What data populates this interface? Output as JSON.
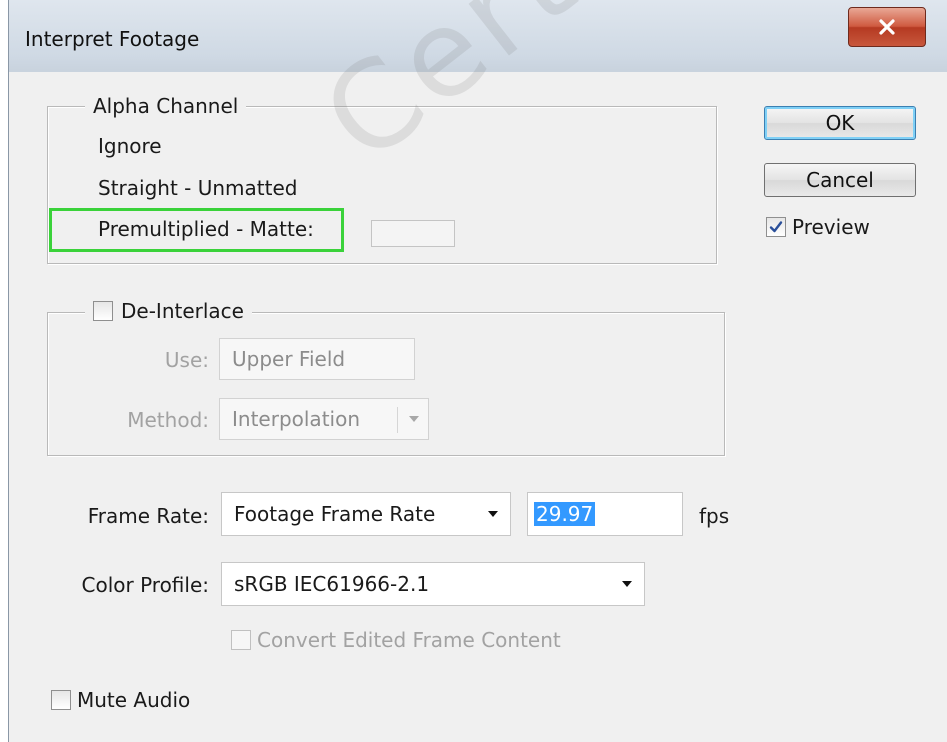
{
  "dialog": {
    "title": "Interpret Footage",
    "close_glyph": "✕"
  },
  "alpha_channel": {
    "legend": "Alpha Channel",
    "options": [
      "Ignore",
      "Straight - Unmatted",
      "Premultiplied - Matte:"
    ]
  },
  "buttons": {
    "ok": "OK",
    "cancel": "Cancel"
  },
  "preview": {
    "label": "Preview",
    "checked": true
  },
  "deinterlace": {
    "legend": "De-Interlace",
    "checked": false,
    "use_label": "Use:",
    "use_value": "Upper Field",
    "method_label": "Method:",
    "method_value": "Interpolation"
  },
  "frame_rate": {
    "label": "Frame Rate:",
    "value": "Footage Frame Rate",
    "fps_value": "29.97",
    "fps_unit": "fps"
  },
  "color_profile": {
    "label": "Color Profile:",
    "value": "sRGB IEC61966-2.1",
    "convert_label": "Convert Edited Frame Content",
    "convert_checked": false
  },
  "mute_audio": {
    "label": "Mute Audio",
    "checked": false
  },
  "watermark": {
    "text": "CertKiller"
  },
  "colors": {
    "highlight": "#3ad23a",
    "close_button": "#c8573c",
    "selection": "#3399ff",
    "default_button_glow": "#7fd0f6"
  }
}
